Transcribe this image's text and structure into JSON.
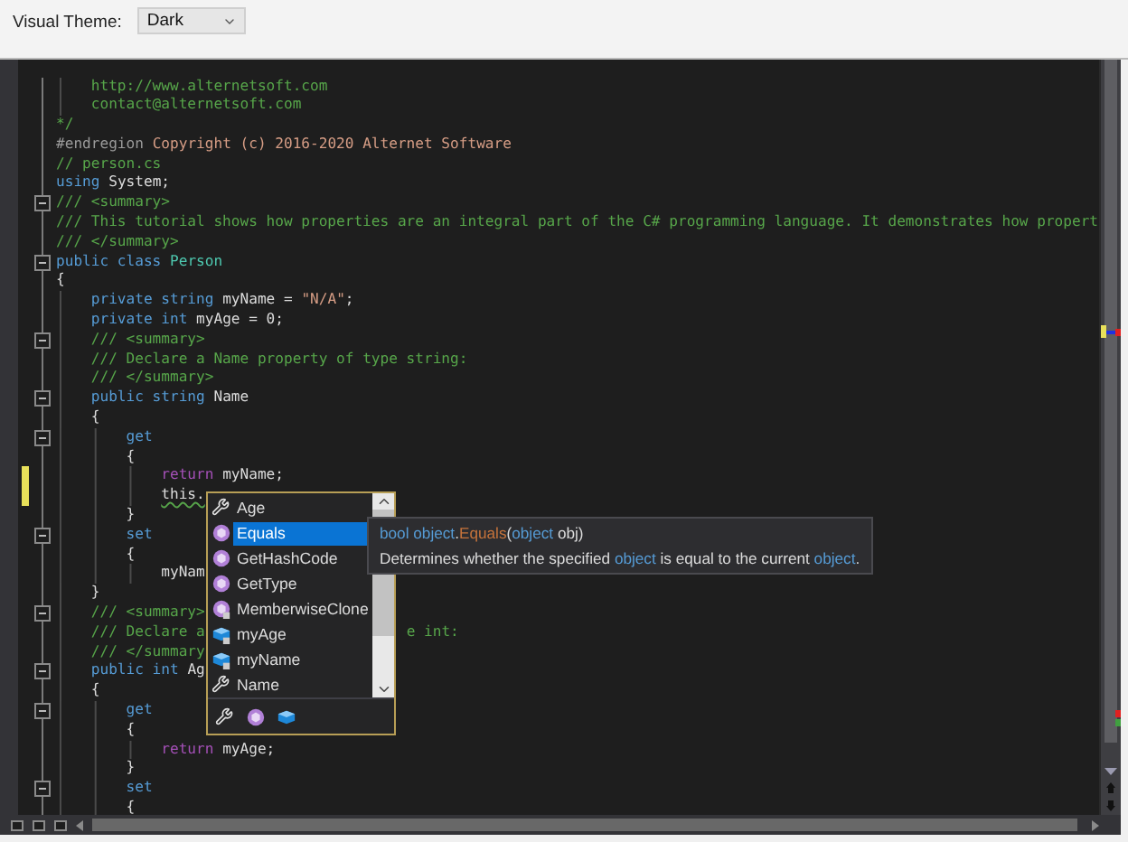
{
  "toolbar": {
    "label": "Visual Theme:",
    "theme_select": {
      "value": "Dark"
    }
  },
  "editor": {
    "lines": [
      {
        "collapsible": false,
        "modified": false,
        "tokens": [
          {
            "kind": "comment",
            "text": "    http://www.alternetsoft.com"
          }
        ]
      },
      {
        "collapsible": false,
        "modified": false,
        "tokens": [
          {
            "kind": "comment",
            "text": "    contact@alternetsoft.com"
          }
        ]
      },
      {
        "collapsible": false,
        "modified": false,
        "tokens": [
          {
            "kind": "comment",
            "text": "*/"
          }
        ]
      },
      {
        "collapsible": false,
        "modified": false,
        "tokens": [
          {
            "kind": "directive",
            "text": "#endregion"
          },
          {
            "kind": "region",
            "text": " Copyright (c) 2016-2020 Alternet Software"
          }
        ]
      },
      {
        "collapsible": false,
        "modified": false,
        "tokens": [
          {
            "kind": "comment",
            "text": "// person.cs"
          }
        ]
      },
      {
        "collapsible": false,
        "modified": false,
        "tokens": [
          {
            "kind": "keyword",
            "text": "using"
          },
          {
            "kind": "plain",
            "text": " System;"
          }
        ]
      },
      {
        "collapsible": true,
        "modified": false,
        "tokens": [
          {
            "kind": "comment",
            "text": "/// <summary>"
          }
        ]
      },
      {
        "collapsible": false,
        "modified": false,
        "tokens": [
          {
            "kind": "comment",
            "text": "/// This tutorial shows how properties are an integral part of the C# programming language. It demonstrates how propert"
          }
        ]
      },
      {
        "collapsible": false,
        "modified": false,
        "tokens": [
          {
            "kind": "comment",
            "text": "/// </summary>"
          }
        ]
      },
      {
        "collapsible": true,
        "modified": false,
        "tokens": [
          {
            "kind": "keyword",
            "text": "public class"
          },
          {
            "kind": "type",
            "text": " Person"
          }
        ]
      },
      {
        "collapsible": false,
        "modified": false,
        "tokens": [
          {
            "kind": "plain",
            "text": "{"
          }
        ]
      },
      {
        "collapsible": false,
        "modified": false,
        "tokens": [
          {
            "kind": "keyword",
            "text": "    private string"
          },
          {
            "kind": "plain",
            "text": " myName = "
          },
          {
            "kind": "string",
            "text": "\"N/A\""
          },
          {
            "kind": "plain",
            "text": ";"
          }
        ]
      },
      {
        "collapsible": false,
        "modified": false,
        "tokens": [
          {
            "kind": "keyword",
            "text": "    private int"
          },
          {
            "kind": "plain",
            "text": " myAge = 0;"
          }
        ]
      },
      {
        "collapsible": true,
        "modified": false,
        "tokens": [
          {
            "kind": "comment",
            "text": "    /// <summary>"
          }
        ]
      },
      {
        "collapsible": false,
        "modified": false,
        "tokens": [
          {
            "kind": "comment",
            "text": "    /// Declare a Name property of type string:"
          }
        ]
      },
      {
        "collapsible": false,
        "modified": false,
        "tokens": [
          {
            "kind": "comment",
            "text": "    /// </summary>"
          }
        ]
      },
      {
        "collapsible": true,
        "modified": false,
        "tokens": [
          {
            "kind": "keyword",
            "text": "    public string"
          },
          {
            "kind": "plain",
            "text": " Name"
          }
        ]
      },
      {
        "collapsible": false,
        "modified": false,
        "tokens": [
          {
            "kind": "plain",
            "text": "    {"
          }
        ]
      },
      {
        "collapsible": true,
        "modified": false,
        "tokens": [
          {
            "kind": "keyword",
            "text": "        get"
          }
        ]
      },
      {
        "collapsible": false,
        "modified": false,
        "tokens": [
          {
            "kind": "plain",
            "text": "        {"
          }
        ]
      },
      {
        "collapsible": false,
        "modified": true,
        "tokens": [
          {
            "kind": "control",
            "text": "            return"
          },
          {
            "kind": "plain",
            "text": " myName;"
          }
        ]
      },
      {
        "collapsible": false,
        "modified": true,
        "tokens": [
          {
            "kind": "squiggle",
            "text": "            this."
          }
        ]
      },
      {
        "collapsible": false,
        "modified": false,
        "tokens": [
          {
            "kind": "plain",
            "text": "        }"
          }
        ]
      },
      {
        "collapsible": true,
        "modified": false,
        "tokens": [
          {
            "kind": "keyword",
            "text": "        set"
          }
        ]
      },
      {
        "collapsible": false,
        "modified": false,
        "tokens": [
          {
            "kind": "plain",
            "text": "        {"
          }
        ]
      },
      {
        "collapsible": false,
        "modified": false,
        "tokens": [
          {
            "kind": "plain",
            "text": "            myNam"
          }
        ]
      },
      {
        "collapsible": false,
        "modified": false,
        "tokens": [
          {
            "kind": "plain",
            "text": "    }"
          }
        ]
      },
      {
        "collapsible": true,
        "modified": false,
        "tokens": [
          {
            "kind": "comment",
            "text": "    /// <summary>"
          }
        ]
      },
      {
        "collapsible": false,
        "modified": false,
        "tokens": [
          {
            "kind": "comment",
            "text": "    /// Declare a"
          },
          {
            "kind": "comment",
            "text": "                       e int:"
          }
        ]
      },
      {
        "collapsible": false,
        "modified": false,
        "tokens": [
          {
            "kind": "comment",
            "text": "    /// </summary"
          }
        ]
      },
      {
        "collapsible": true,
        "modified": false,
        "tokens": [
          {
            "kind": "keyword",
            "text": "    public int"
          },
          {
            "kind": "plain",
            "text": " Ag"
          }
        ]
      },
      {
        "collapsible": false,
        "modified": false,
        "tokens": [
          {
            "kind": "plain",
            "text": "    {"
          }
        ]
      },
      {
        "collapsible": true,
        "modified": false,
        "tokens": [
          {
            "kind": "keyword",
            "text": "        get"
          }
        ]
      },
      {
        "collapsible": false,
        "modified": false,
        "tokens": [
          {
            "kind": "plain",
            "text": "        {"
          }
        ]
      },
      {
        "collapsible": false,
        "modified": false,
        "tokens": [
          {
            "kind": "control",
            "text": "            return"
          },
          {
            "kind": "plain",
            "text": " myAge;"
          }
        ]
      },
      {
        "collapsible": false,
        "modified": false,
        "tokens": [
          {
            "kind": "plain",
            "text": "        }"
          }
        ]
      },
      {
        "collapsible": true,
        "modified": false,
        "tokens": [
          {
            "kind": "keyword",
            "text": "        set"
          }
        ]
      },
      {
        "collapsible": false,
        "modified": false,
        "tokens": [
          {
            "kind": "plain",
            "text": "        {"
          }
        ]
      }
    ]
  },
  "completion": {
    "items": [
      {
        "kind": "property",
        "label": "Age",
        "private": false,
        "selected": false
      },
      {
        "kind": "method",
        "label": "Equals",
        "private": false,
        "selected": true
      },
      {
        "kind": "method",
        "label": "GetHashCode",
        "private": false,
        "selected": false
      },
      {
        "kind": "method",
        "label": "GetType",
        "private": false,
        "selected": false
      },
      {
        "kind": "method",
        "label": "MemberwiseClone",
        "private": true,
        "selected": false
      },
      {
        "kind": "field",
        "label": "myAge",
        "private": true,
        "selected": false
      },
      {
        "kind": "field",
        "label": "myName",
        "private": true,
        "selected": false
      },
      {
        "kind": "property",
        "label": "Name",
        "private": false,
        "selected": false
      }
    ],
    "filters": [
      {
        "kind": "property"
      },
      {
        "kind": "method"
      },
      {
        "kind": "field"
      }
    ]
  },
  "tooltip": {
    "signature": [
      {
        "kind": "keyword",
        "text": "bool object"
      },
      {
        "kind": "plain",
        "text": "."
      },
      {
        "kind": "method",
        "text": "Equals"
      },
      {
        "kind": "plain",
        "text": "("
      },
      {
        "kind": "keyword",
        "text": "object"
      },
      {
        "kind": "plain",
        "text": " obj)"
      }
    ],
    "description": [
      {
        "kind": "plain",
        "text": "Determines whether the specified "
      },
      {
        "kind": "keyword",
        "text": "object"
      },
      {
        "kind": "plain",
        "text": " is equal to the current "
      },
      {
        "kind": "keyword",
        "text": "object"
      },
      {
        "kind": "plain",
        "text": "."
      }
    ]
  }
}
